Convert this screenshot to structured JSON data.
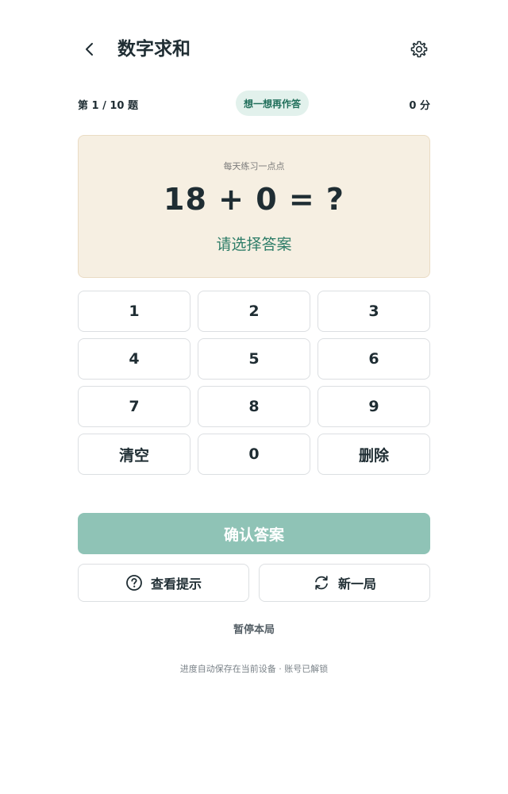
{
  "header": {
    "title": "数字求和",
    "back_icon": "chevron-left-icon",
    "settings_icon": "gear-icon"
  },
  "status": {
    "progress": "第 1 / 10 题",
    "badge": "想一想再作答",
    "score": "0 分"
  },
  "question": {
    "subtitle": "每天练习一点点",
    "expression": "18 + 0 = ?",
    "prompt": "请选择答案"
  },
  "keypad": {
    "keys": [
      "1",
      "2",
      "3",
      "4",
      "5",
      "6",
      "7",
      "8",
      "9",
      "清空",
      "0",
      "删除"
    ]
  },
  "actions": {
    "confirm": "确认答案",
    "hint": "查看提示",
    "hint_icon": "question-circle-icon",
    "new_game": "新一局",
    "new_game_icon": "refresh-icon",
    "pause": "暂停本局"
  },
  "footer": {
    "note": "进度自动保存在当前设备 · 账号已解锁"
  },
  "colors": {
    "accent": "#2e7d68",
    "badge_bg": "#e2f1ec",
    "card_bg": "#f6efe2",
    "confirm_bg": "#8fc3b6"
  }
}
